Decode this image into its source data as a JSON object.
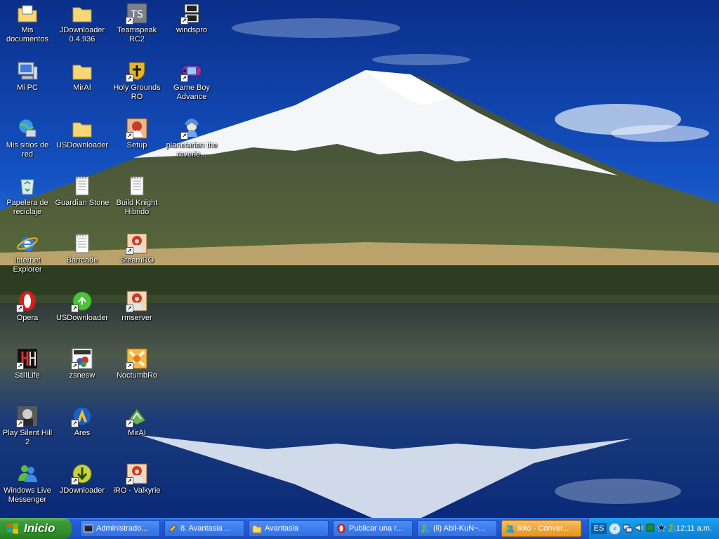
{
  "desktop": {
    "icons": [
      {
        "label": "Mis documentos",
        "icon": "documents-folder-icon"
      },
      {
        "label": "JDownloader 0.4.936",
        "icon": "folder-icon"
      },
      {
        "label": "Teamspeak RC2",
        "icon": "teamspeak-icon"
      },
      {
        "label": "windspro",
        "icon": "ds-icon"
      },
      {
        "label": "Mi PC",
        "icon": "computer-icon"
      },
      {
        "label": "MirAI",
        "icon": "folder-icon"
      },
      {
        "label": "Holy Grounds RO",
        "icon": "crest-icon"
      },
      {
        "label": "Game Boy Advance",
        "icon": "gameboy-icon"
      },
      {
        "label": "Mis sitios de red",
        "icon": "network-icon"
      },
      {
        "label": "USDownloader",
        "icon": "folder-icon"
      },
      {
        "label": "Setup",
        "icon": "setup-icon"
      },
      {
        "label": "planetarian the reverie...",
        "icon": "planetarian-icon"
      },
      {
        "label": "Papelera de reciclaje",
        "icon": "recycle-bin-icon"
      },
      {
        "label": "Guardian Stone",
        "icon": "text-file-icon"
      },
      {
        "label": "Build Knight Hibrido",
        "icon": "text-file-icon"
      },
      {
        "label": "Internet Explorer",
        "icon": "internet-explorer-icon"
      },
      {
        "label": "Barrcade",
        "icon": "text-file-icon"
      },
      {
        "label": "SteamRO",
        "icon": "ro-icon"
      },
      {
        "label": "Opera",
        "icon": "opera-icon"
      },
      {
        "label": "USDownloader",
        "icon": "usdownloader-icon"
      },
      {
        "label": "rmserver",
        "icon": "ro-icon"
      },
      {
        "label": "StillLife",
        "icon": "stilllife-icon"
      },
      {
        "label": "zsnesw",
        "icon": "zsnes-icon"
      },
      {
        "label": "NoctumbRo",
        "icon": "noctumbro-icon"
      },
      {
        "label": "Play Silent Hill 2",
        "icon": "silent-hill-icon"
      },
      {
        "label": "Ares",
        "icon": "ares-icon"
      },
      {
        "label": "MirAI",
        "icon": "mirai-icon"
      },
      {
        "label": "Windows Live Messenger",
        "icon": "messenger-icon"
      },
      {
        "label": "JDownloader",
        "icon": "jdownloader-icon"
      },
      {
        "label": "iRO - Valkyrie",
        "icon": "ro-icon"
      }
    ]
  },
  "taskbar": {
    "start_label": "Inicio",
    "tasks": [
      {
        "label": "Administrado...",
        "icon": "console-icon"
      },
      {
        "label": "8. Avantasia ...",
        "icon": "pencil-icon"
      },
      {
        "label": "Avantasia",
        "icon": "folder-icon"
      },
      {
        "label": "Publicar una r...",
        "icon": "opera-icon"
      },
      {
        "label": "(li) Abii-KuN~...",
        "icon": "messenger-icon"
      },
      {
        "label": "ikko - Conver...",
        "icon": "messenger-icon"
      }
    ],
    "tray": {
      "language": "ES",
      "clock": "12:11 a.m.",
      "icons": [
        "network-icon",
        "volume-icon",
        "green-square-icon",
        "star-icon",
        "messenger-icon"
      ]
    }
  },
  "colors": {
    "taskbar": "#245edb",
    "start": "#3c9a36",
    "tray": "#118fe2",
    "active_task": "#f0a739"
  }
}
